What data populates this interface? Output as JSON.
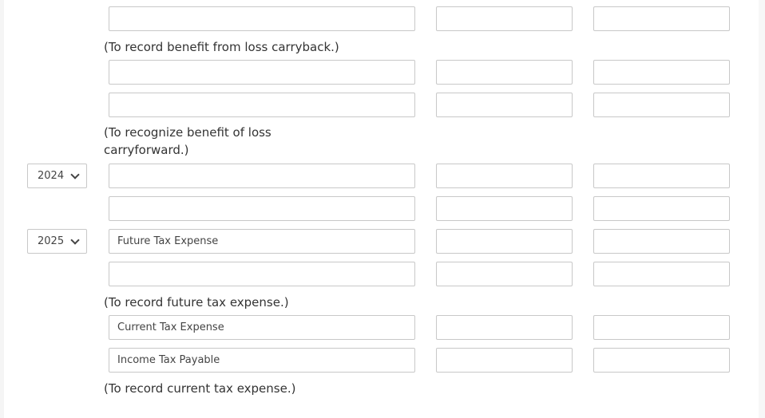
{
  "notes": {
    "carryback": "(To record benefit from loss carryback.)",
    "carryforward_1": "(To recognize benefit of loss",
    "carryforward_2": "carryforward.)",
    "future": "(To record future tax expense.)",
    "current": "(To record current tax expense.)"
  },
  "rows": [
    {
      "year": "",
      "account": ""
    },
    {
      "year": "",
      "account": ""
    },
    {
      "year": "",
      "account": ""
    },
    {
      "year": "2024",
      "account": ""
    },
    {
      "year": "",
      "account": ""
    },
    {
      "year": "2025",
      "account": "Future Tax Expense"
    },
    {
      "year": "",
      "account": ""
    },
    {
      "year": "",
      "account": "Current Tax Expense"
    },
    {
      "year": "",
      "account": "Income Tax Payable"
    }
  ]
}
